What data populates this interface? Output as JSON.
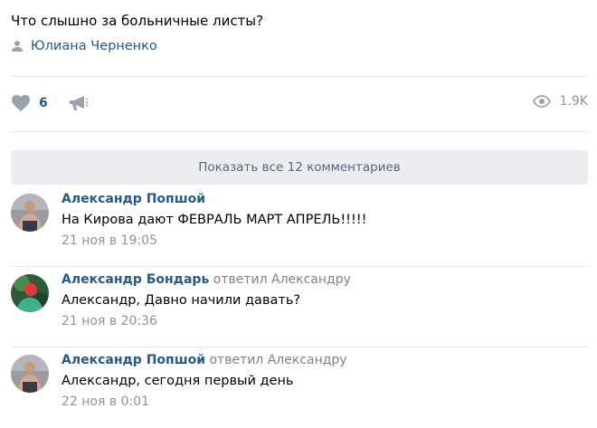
{
  "post": {
    "text": "Что слышно за больничные листы?",
    "author": "Юлиана Черненко",
    "author_icon": "user-icon"
  },
  "actions": {
    "likes": "6",
    "like_icon": "heart-icon",
    "share_icon": "megaphone-icon",
    "views": "1.9K",
    "views_icon": "eye-icon"
  },
  "show_all": "Показать все 12 комментариев",
  "comments": [
    {
      "author": "Александр Попшой",
      "reply_to": "",
      "text": "На Кирова дают ФЕВРАЛЬ МАРТ АПРЕЛЬ!!!!!",
      "date": "21 ноя в 19:05"
    },
    {
      "author": "Александр Бондарь",
      "reply_to": "ответил Александру",
      "text": "Александр, Давно начили давать?",
      "date": "21 ноя в 20:36"
    },
    {
      "author": "Александр Попшой",
      "reply_to": "ответил Александру",
      "text": "Александр, сегодня первый день",
      "date": "22 ноя в 0:01"
    }
  ],
  "colors": {
    "link": "#2a5885",
    "muted": "#939393",
    "button_bg": "#ebedf0",
    "divider": "#e7e8ec"
  }
}
